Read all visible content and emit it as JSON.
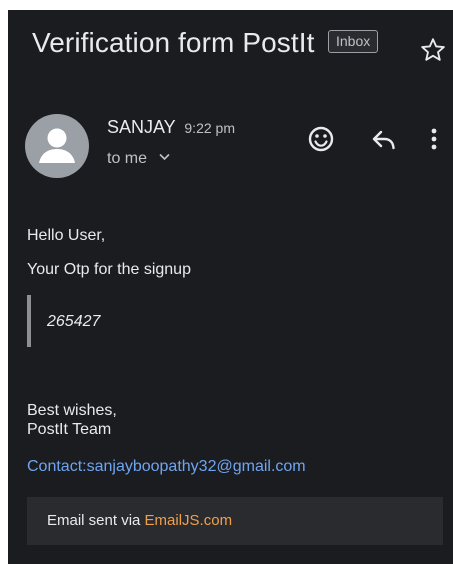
{
  "email": {
    "subject": "Verification form PostIt",
    "label": "Inbox",
    "sender_name": "SANJAY",
    "time": "9:22 pm",
    "recipient": "to me",
    "greeting": "Hello User,",
    "message": "Your Otp for the signup",
    "otp": "265427",
    "signoff_line1": "Best wishes,",
    "signoff_line2": "PostIt Team",
    "contact": "Contact:sanjayboopathy32@gmail.com",
    "footer_prefix": "Email sent via ",
    "footer_link": "EmailJS.com"
  },
  "icons": {
    "star": "star-icon",
    "avatar": "person-icon",
    "emoji": "smiley-icon",
    "reply": "reply-icon",
    "more": "more-vertical-icon",
    "expand": "chevron-down-icon"
  },
  "colors": {
    "background": "#1b1c20",
    "text": "#e8eaed",
    "link": "#6fa5f0",
    "footer_link": "#f0a04b",
    "footer_bg": "#2a2b2f"
  }
}
